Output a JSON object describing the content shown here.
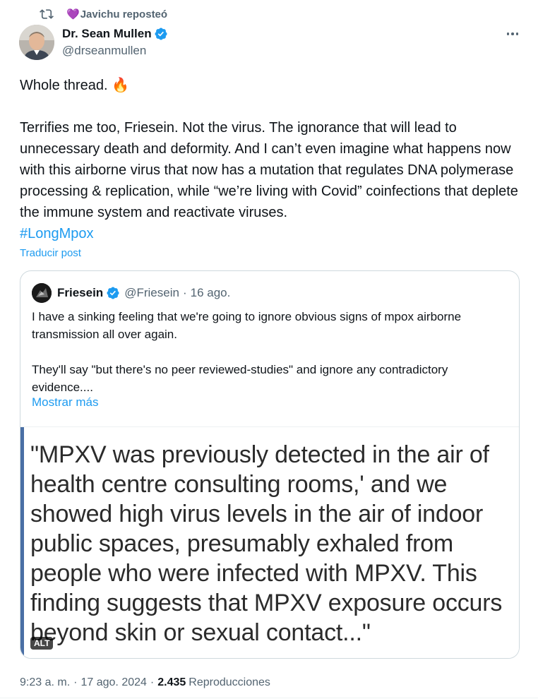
{
  "repost": {
    "name": "Javichu",
    "label": "Javichu reposteó"
  },
  "author": {
    "name": "Dr. Sean Mullen",
    "handle": "@drseanmullen"
  },
  "tweet": {
    "body": "Whole thread. 🔥\n\nTerrifies me too, Friesein. Not the virus. The ignorance that will lead to unnecessary death and deformity. And I can’t even imagine what happens now with this airborne virus that now has a mutation that regulates DNA polymerase processing & replication, while “we’re living with Covid” coinfections that deplete the immune system and reactivate viruses.",
    "hashtag": "#LongMpox",
    "translate": "Traducir post"
  },
  "quote": {
    "name": "Friesein",
    "handle": "@Friesein",
    "date": "16 ago.",
    "text": "I have a sinking feeling that we're going to ignore obvious signs of mpox airborne transmission all over again.\n\nThey'll say \"but there's no peer reviewed-studies\" and ignore any contradictory evidence....",
    "show_more": "Mostrar más",
    "image_text": "\"MPXV was previously detected in the air of health centre consulting rooms,' and we showed high virus levels in the air of indoor public spaces, presumably exhaled from people who were infected with MPXV. This finding suggests that MPXV exposure occurs beyond skin or sexual contact...\"",
    "alt_badge": "ALT"
  },
  "footer": {
    "time": "9:23 a. m.",
    "date": "17 ago. 2024",
    "views": "2.435",
    "views_label": "Reproducciones"
  },
  "colors": {
    "accent": "#1d9bf0",
    "secondary_text": "#536471",
    "primary_text": "#0f1419",
    "border": "#cfd9de"
  },
  "icons": [
    "repost-icon",
    "purple-heart-icon",
    "verified-badge-icon",
    "more-icon",
    "fire-emoji"
  ]
}
